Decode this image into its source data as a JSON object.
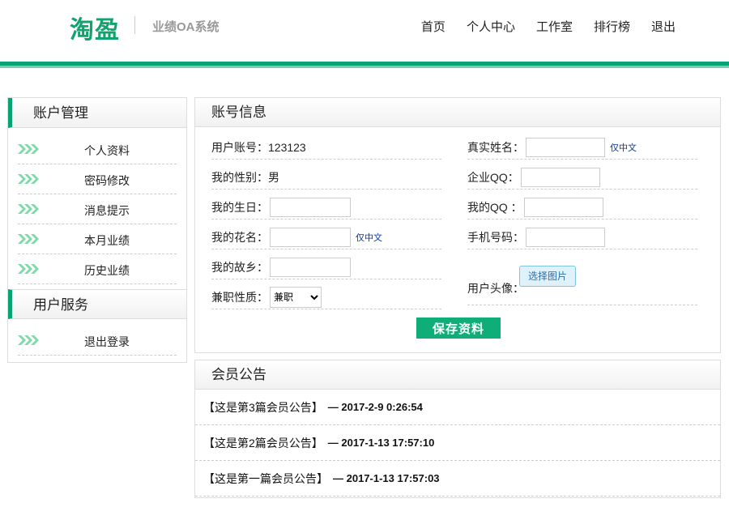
{
  "header": {
    "logo": "淘盈",
    "subtitle": "业绩OA系统",
    "nav": [
      "首页",
      "个人中心",
      "工作室",
      "排行榜",
      "退出"
    ]
  },
  "sidebar": {
    "account_title": "账户管理",
    "account_items": [
      "个人资料",
      "密码修改",
      "消息提示",
      "本月业绩",
      "历史业绩"
    ],
    "service_title": "用户服务",
    "service_items": [
      "退出登录"
    ]
  },
  "account": {
    "title": "账号信息",
    "user_account_label": "用户账号：",
    "user_account_value": "123123",
    "gender_label": "我的性别：",
    "gender_value": "男",
    "birthday_label": "我的生日：",
    "nickname_label": "我的花名：",
    "hometown_label": "我的故乡：",
    "parttime_label": "兼职性质：",
    "parttime_value": "兼职",
    "realname_label": "真实姓名：",
    "company_qq_label": "企业QQ：",
    "my_qq_label": "我的QQ ：",
    "phone_label": "手机号码：",
    "avatar_label": "用户头像：",
    "only_chinese_note": "仅中文",
    "choose_image": "选择图片",
    "save_label": "保存资料"
  },
  "notice": {
    "title": "会员公告",
    "items": [
      {
        "title": "【这是第3篇会员公告】",
        "date": "— 2017-2-9 0:26:54"
      },
      {
        "title": "【这是第2篇会员公告】",
        "date": "— 2017-1-13 17:57:10"
      },
      {
        "title": "【这是第一篇会员公告】",
        "date": "— 2017-1-13 17:57:03"
      }
    ]
  },
  "colors": {
    "brand_green": "#0aa273",
    "save_button": "#0fae78",
    "note_blue": "#0a3a9e"
  }
}
